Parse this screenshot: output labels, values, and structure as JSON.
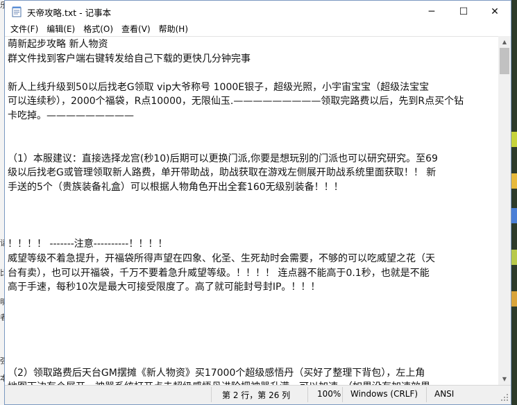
{
  "window": {
    "title": "天帝攻略.txt - 记事本"
  },
  "titlebar_buttons": {
    "minimize_icon": "─",
    "maximize_icon": "☐",
    "close_icon": "✕"
  },
  "menu": [
    "文件(F)",
    "编辑(E)",
    "格式(O)",
    "查看(V)",
    "帮助(H)"
  ],
  "document": {
    "lines": [
      "萌新起步攻略  新人物资",
      "群文件找到客户端右键转发给自己下载的更快几分钟完事",
      "",
      "新人上线升级到50以后找老G领取   vip大爷称号   1000E银子，超级光照，小宇宙宝宝（超级法宝宝",
      "可以连续秒），2000个福袋，R点10000，无限仙玉.—————————领取完路费以后，先到R点买个钻",
      "卡吃掉。—————————",
      "",
      "",
      "（1）本服建议：直接选择龙宫(秒10)后期可以更换门派,你要是想玩别的门派也可以研究研究。至69",
      "级以后找老G或管理领取新人路费，单开带助战，助战获取在游戏左侧展开助战系统里面获取！！ 新",
      "手送的5个（贵族装备礼盒）可以根据人物角色开出全套160无级别装备！！！",
      "",
      "",
      "",
      "                             ！！！！ -------注意----------！！！！",
      "威望等级不着急提升，开福袋所得声望在四象、化圣、生死劫时会需要，不够的可以吃威望之花（天",
      "台有卖），也可以开福袋，千万不要着急升威望等级。！！！！   连点器不能高于0.1秒，也就是不能",
      "高于手速，每秒10次是最大可接受限度了。高了就可能封号封IP。！！！",
      "",
      "",
      "",
      "",
      "",
      "（2）领取路费后天台GM摆摊《新人物资》买17000个超级感悟丹（买好了整理下背包），左上角",
      "地图下边有个展开，神器系统打开点击超级感悟丹进阶把神器升满，可以加速。（如果没有加速效果"
    ]
  },
  "statusbar": {
    "position": "第 2 行，第 26 列",
    "zoom": "100%",
    "line_ending": "Windows (CRLF)",
    "encoding": "ANSI"
  },
  "background": {
    "left_chars": [
      "乐",
      "请",
      "比",
      "明",
      "者",
      "强",
      "本"
    ],
    "right_colors": [
      "#c6d33a",
      "#e7b93b",
      "#4a7fd6",
      "#b8c94a",
      "#d9a43a"
    ]
  },
  "colors": {
    "window_border": "#7a98c0",
    "statusbar_bg": "#f0f0f0",
    "scroll_thumb": "#c1c1c1",
    "text": "#111111"
  }
}
